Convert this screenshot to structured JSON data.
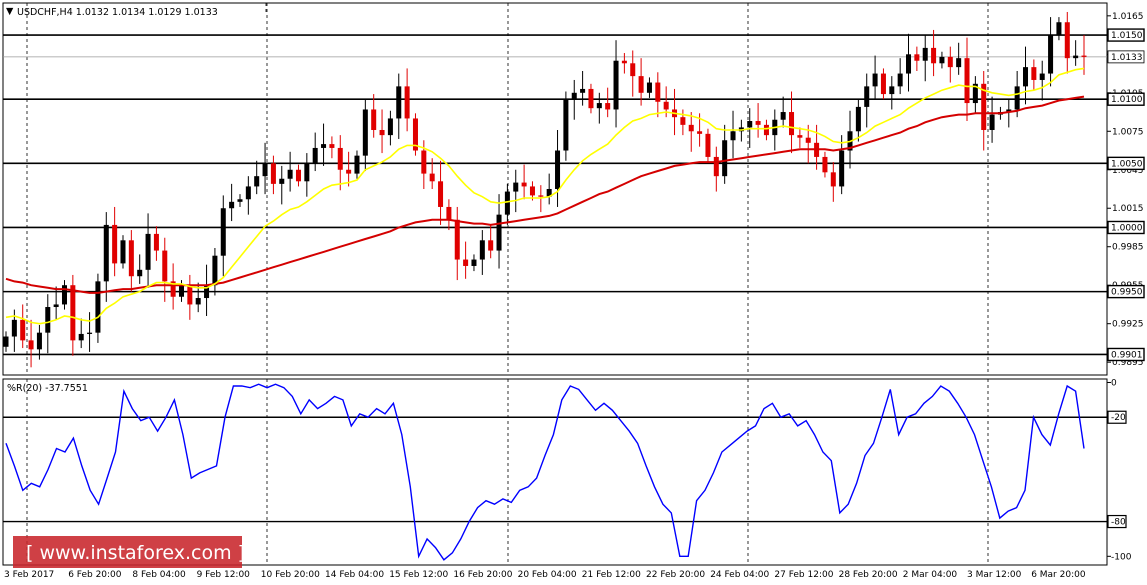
{
  "chart_data": [
    {
      "type": "candlestick",
      "title": "USDCHF,H4  1.0132 1.0134 1.0129 1.0133",
      "symbol": "USDCHF",
      "timeframe": "H4",
      "ohlc_header": {
        "open": "1.0132",
        "high": "1.0134",
        "low": "1.0129",
        "close": "1.0133"
      },
      "ylim": [
        0.9885,
        1.0175
      ],
      "y_ticks": [
        "1.0165",
        "1.0135",
        "1.0105",
        "1.0075",
        "1.0045",
        "1.0015",
        "0.9985",
        "0.9955",
        "0.9925",
        "0.9895"
      ],
      "x_tick_labels": [
        "3 Feb 2017",
        "6 Feb 20:00",
        "8 Feb 04:00",
        "9 Feb 12:00",
        "10 Feb 20:00",
        "14 Feb 04:00",
        "15 Feb 12:00",
        "16 Feb 20:00",
        "20 Feb 04:00",
        "21 Feb 12:00",
        "22 Feb 20:00",
        "24 Feb 04:00",
        "27 Feb 12:00",
        "28 Feb 20:00",
        "2 Mar 04:00",
        "3 Mar 12:00",
        "6 Mar 20:00"
      ],
      "horizontal_levels": [
        "1.0150",
        "1.0100",
        "1.0050",
        "1.0000",
        "0.9950",
        "0.9901"
      ],
      "current_price": "1.0133",
      "colors": {
        "up": "#000000",
        "down": "#e00000",
        "ma_fast": "#ffff00",
        "ma_slow": "#d40000",
        "levels": "#000000"
      },
      "series": [
        {
          "kind": "candles",
          "close": [
            0.9915,
            0.9928,
            0.9912,
            0.9905,
            0.9918,
            0.9938,
            0.994,
            0.9955,
            0.9912,
            0.9917,
            0.9918,
            0.9958,
            1.0002,
            0.9972,
            0.999,
            0.9962,
            0.9967,
            0.9995,
            0.9982,
            0.9958,
            0.9946,
            0.9955,
            0.994,
            0.9945,
            0.9955,
            0.9978,
            1.0015,
            1.002,
            1.0022,
            1.0032,
            1.004,
            1.005,
            1.0034,
            1.0038,
            1.0045,
            1.0036,
            1.005,
            1.0062,
            1.0065,
            1.0062,
            1.0045,
            1.0042,
            1.0056,
            1.0092,
            1.0076,
            1.0072,
            1.0085,
            1.011,
            1.0085,
            1.006,
            1.0042,
            1.0036,
            1.0016,
            1.0006,
            0.9975,
            0.997,
            0.9975,
            0.999,
            0.9982,
            1.001,
            1.0028,
            1.0035,
            1.0032,
            1.0025,
            1.0024,
            1.003,
            1.006,
            1.01,
            1.0105,
            1.0108,
            1.0093,
            1.0097,
            1.0092,
            1.013,
            1.0128,
            1.0118,
            1.0105,
            1.0113,
            1.0098,
            1.0092,
            1.0086,
            1.008,
            1.0075,
            1.0073,
            1.0055,
            1.004,
            1.0068,
            1.0075,
            1.0078,
            1.0083,
            1.008,
            1.0072,
            1.0084,
            1.009,
            1.0072,
            1.007,
            1.0066,
            1.0055,
            1.0043,
            1.0032,
            1.006,
            1.0075,
            1.0094,
            1.011,
            1.012,
            1.0104,
            1.011,
            1.012,
            1.0135,
            1.013,
            1.014,
            1.0128,
            1.0133,
            1.0125,
            1.0132,
            1.0097,
            1.0112,
            1.0076,
            1.0088,
            1.009,
            1.0092,
            1.011,
            1.0125,
            1.0115,
            1.012,
            1.015,
            1.016,
            1.0132,
            1.0134,
            1.0133
          ],
          "ema_fast": [
            0.993,
            0.9931,
            0.9929,
            0.9926,
            0.9925,
            0.9926,
            0.9928,
            0.9931,
            0.993,
            0.9928,
            0.9927,
            0.993,
            0.9937,
            0.9941,
            0.9946,
            0.9948,
            0.995,
            0.9954,
            0.9957,
            0.9957,
            0.9956,
            0.9956,
            0.9954,
            0.9953,
            0.9953,
            0.9956,
            0.9961,
            0.9969,
            0.9977,
            0.9985,
            0.9993,
            1.0001,
            1.0005,
            1.001,
            1.0014,
            1.0016,
            1.002,
            1.0025,
            1.003,
            1.0033,
            1.0034,
            1.0035,
            1.0037,
            1.0045,
            1.0048,
            1.0051,
            1.0055,
            1.0061,
            1.0064,
            1.0064,
            1.0062,
            1.0059,
            1.0054,
            1.0048,
            1.004,
            1.0033,
            1.0027,
            1.0024,
            1.002,
            1.0019,
            1.002,
            1.0021,
            1.0023,
            1.0023,
            1.0023,
            1.0024,
            1.0028,
            1.0037,
            1.0045,
            1.0052,
            1.0057,
            1.0061,
            1.0065,
            1.0072,
            1.0078,
            1.0083,
            1.0085,
            1.0088,
            1.0089,
            1.009,
            1.0089,
            1.0088,
            1.0087,
            1.0085,
            1.0082,
            1.0077,
            1.0076,
            1.0076,
            1.0076,
            1.0077,
            1.0077,
            1.0077,
            1.0078,
            1.0079,
            1.0078,
            1.0077,
            1.0076,
            1.0074,
            1.0071,
            1.0067,
            1.0066,
            1.0067,
            1.007,
            1.0074,
            1.0079,
            1.0082,
            1.0085,
            1.0088,
            1.0093,
            1.0097,
            1.0101,
            1.0104,
            1.0107,
            1.0109,
            1.0111,
            1.011,
            1.011,
            1.0107,
            1.0105,
            1.0104,
            1.0103,
            1.0104,
            1.0106,
            1.0107,
            1.0109,
            1.0113,
            1.0119,
            1.0121,
            1.0123,
            1.0124
          ],
          "ema_slow": [
            0.996,
            0.9958,
            0.9957,
            0.9955,
            0.9954,
            0.9953,
            0.9952,
            0.9952,
            0.9951,
            0.995,
            0.9949,
            0.9949,
            0.995,
            0.9951,
            0.9952,
            0.9952,
            0.9953,
            0.9954,
            0.9955,
            0.9955,
            0.9955,
            0.9955,
            0.9955,
            0.9955,
            0.9955,
            0.9956,
            0.9957,
            0.9959,
            0.9961,
            0.9963,
            0.9965,
            0.9967,
            0.9969,
            0.9971,
            0.9973,
            0.9975,
            0.9977,
            0.9979,
            0.9981,
            0.9983,
            0.9985,
            0.9987,
            0.9989,
            0.9991,
            0.9993,
            0.9995,
            0.9997,
            1.0,
            1.0002,
            1.0004,
            1.0005,
            1.0006,
            1.0006,
            1.0006,
            1.0005,
            1.0004,
            1.0003,
            1.0003,
            1.0002,
            1.0003,
            1.0004,
            1.0005,
            1.0006,
            1.0007,
            1.0008,
            1.0009,
            1.0011,
            1.0014,
            1.0017,
            1.002,
            1.0023,
            1.0026,
            1.0028,
            1.0031,
            1.0034,
            1.0037,
            1.004,
            1.0042,
            1.0044,
            1.0046,
            1.0048,
            1.0049,
            1.005,
            1.0051,
            1.0051,
            1.0051,
            1.0052,
            1.0053,
            1.0054,
            1.0055,
            1.0056,
            1.0057,
            1.0058,
            1.0059,
            1.006,
            1.0061,
            1.0061,
            1.0061,
            1.0061,
            1.006,
            1.0061,
            1.0062,
            1.0064,
            1.0066,
            1.0068,
            1.007,
            1.0072,
            1.0074,
            1.0077,
            1.0079,
            1.0082,
            1.0084,
            1.0086,
            1.0087,
            1.0088,
            1.0088,
            1.0089,
            1.0089,
            1.0089,
            1.0089,
            1.009,
            1.0091,
            1.0093,
            1.0094,
            1.0095,
            1.0097,
            1.0099,
            1.01,
            1.0101,
            1.0102
          ]
        }
      ]
    },
    {
      "type": "line",
      "title": "%R(20) -37.7551",
      "indicator": "Williams %R",
      "period": 20,
      "last_value": "-37.7551",
      "ylim": [
        -105,
        2
      ],
      "y_ticks": [
        "0",
        "-20",
        "-80",
        "-100"
      ],
      "horizontal_levels": [
        -20,
        -80
      ],
      "colors": {
        "line": "#0000ff"
      },
      "series": [
        {
          "values": [
            -35,
            -48,
            -62,
            -58,
            -60,
            -50,
            -38,
            -40,
            -32,
            -48,
            -62,
            -70,
            -55,
            -40,
            -5,
            -15,
            -22,
            -20,
            -28,
            -20,
            -10,
            -30,
            -55,
            -52,
            -50,
            -48,
            -20,
            -2,
            -2,
            -3,
            -1,
            -3,
            -1,
            -3,
            -8,
            -18,
            -10,
            -15,
            -12,
            -8,
            -10,
            -25,
            -18,
            -20,
            -15,
            -18,
            -12,
            -30,
            -60,
            -100,
            -90,
            -95,
            -102,
            -98,
            -90,
            -80,
            -72,
            -68,
            -70,
            -67,
            -69,
            -62,
            -60,
            -55,
            -42,
            -30,
            -10,
            -2,
            -4,
            -10,
            -16,
            -12,
            -16,
            -22,
            -28,
            -35,
            -48,
            -60,
            -70,
            -75,
            -100,
            -100,
            -68,
            -62,
            -52,
            -40,
            -36,
            -32,
            -28,
            -25,
            -15,
            -12,
            -20,
            -18,
            -25,
            -22,
            -30,
            -40,
            -45,
            -75,
            -70,
            -58,
            -42,
            -35,
            -20,
            -4,
            -30,
            -20,
            -18,
            -12,
            -8,
            -2,
            -5,
            -12,
            -20,
            -30,
            -45,
            -60,
            -78,
            -74,
            -72,
            -62,
            -20,
            -30,
            -36,
            -18,
            -2,
            -5,
            -38
          ]
        }
      ]
    }
  ],
  "ui": {
    "dropdown_glyph": "▼",
    "watermark": "[ www.instaforex.com ]"
  }
}
